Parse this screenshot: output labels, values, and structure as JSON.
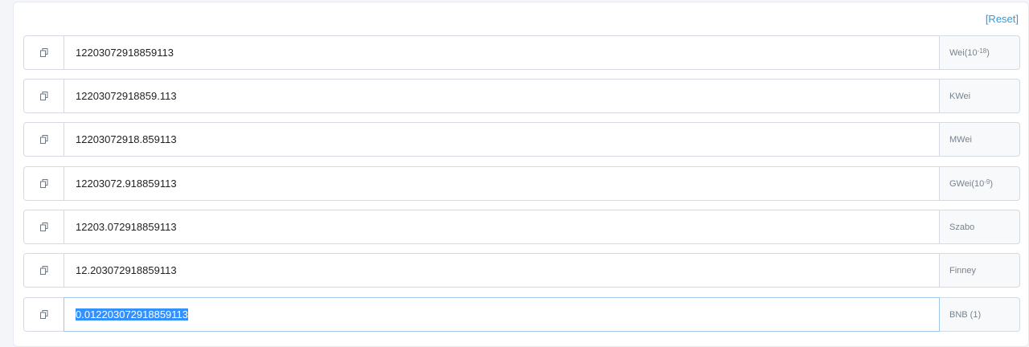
{
  "header": {
    "reset_label": "[Reset]"
  },
  "rows": [
    {
      "value": "12203072918859113",
      "unit": "Wei",
      "exponent_prefix": " (10",
      "exponent": "-18",
      "exponent_suffix": ")"
    },
    {
      "value": "12203072918859.113",
      "unit": "KWei"
    },
    {
      "value": "12203072918.859113",
      "unit": "MWei"
    },
    {
      "value": "12203072.918859113",
      "unit": "GWei",
      "exponent_prefix": " (10",
      "exponent": "-9",
      "exponent_suffix": ")"
    },
    {
      "value": "12203.072918859113",
      "unit": "Szabo"
    },
    {
      "value": "12.203072918859113",
      "unit": "Finney"
    },
    {
      "value": "0.012203072918859113",
      "unit": "BNB (1)",
      "selected": true
    }
  ],
  "icons": {
    "copy": "copy-icon"
  },
  "colors": {
    "link": "#3498db",
    "selection": "#3390ff",
    "border": "#d5dae2",
    "active_border": "#9fc7ee"
  }
}
